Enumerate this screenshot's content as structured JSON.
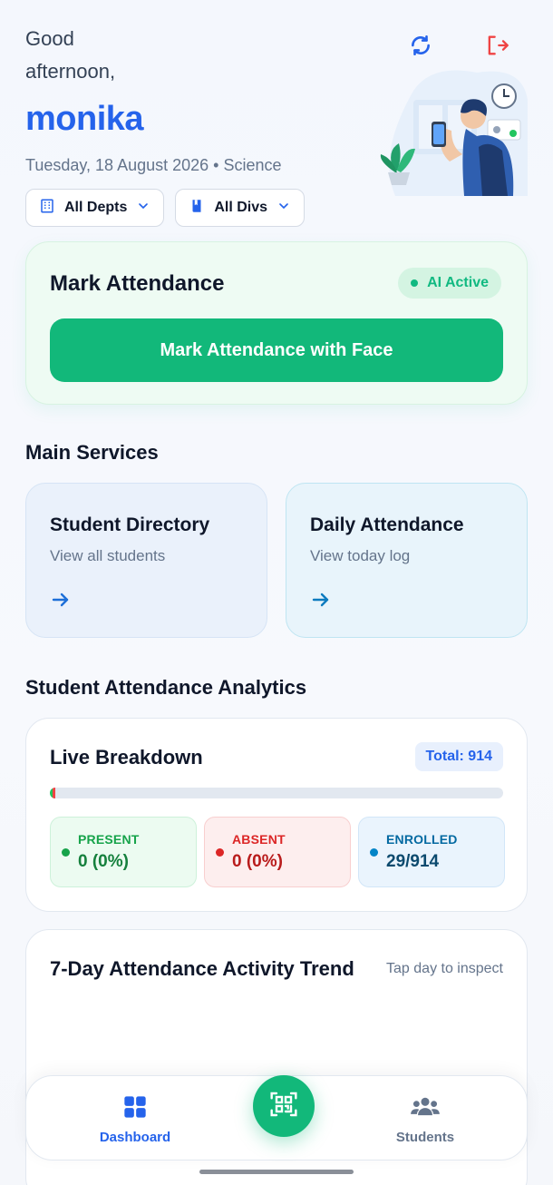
{
  "header": {
    "greeting_line1": "Good",
    "greeting_line2": "afternoon,",
    "user_name": "monika",
    "date_line": "Tuesday, 18 August 2026 • Science"
  },
  "filters": {
    "dept_label": "All Depts",
    "div_label": "All Divs"
  },
  "mark_attendance": {
    "title": "Mark Attendance",
    "status_badge": "AI Active",
    "button_label": "Mark Attendance with Face"
  },
  "services": {
    "section_title": "Main Services",
    "items": [
      {
        "title": "Student Directory",
        "subtitle": "View all students"
      },
      {
        "title": "Daily Attendance",
        "subtitle": "View today log"
      }
    ]
  },
  "analytics": {
    "section_title": "Student Attendance Analytics",
    "live": {
      "title": "Live Breakdown",
      "total_label": "Total: 914",
      "present_fraction": 0.0,
      "absent_fraction": 0.0,
      "stats": [
        {
          "label": "PRESENT",
          "value": "0 (0%)",
          "color": "#16a34a"
        },
        {
          "label": "ABSENT",
          "value": "0 (0%)",
          "color": "#dc2626"
        },
        {
          "label": "ENROLLED",
          "value": "29/914",
          "color": "#0369a1"
        }
      ]
    },
    "trend": {
      "title": "7-Day Attendance Activity Trend",
      "hint": "Tap day to inspect"
    }
  },
  "bottom_nav": {
    "items": [
      {
        "label": "Dashboard",
        "active": true
      },
      {
        "label": "Students",
        "active": false
      }
    ]
  },
  "colors": {
    "accent_blue": "#2563eb",
    "accent_green": "#12b87a",
    "logout_red": "#ef4444"
  }
}
